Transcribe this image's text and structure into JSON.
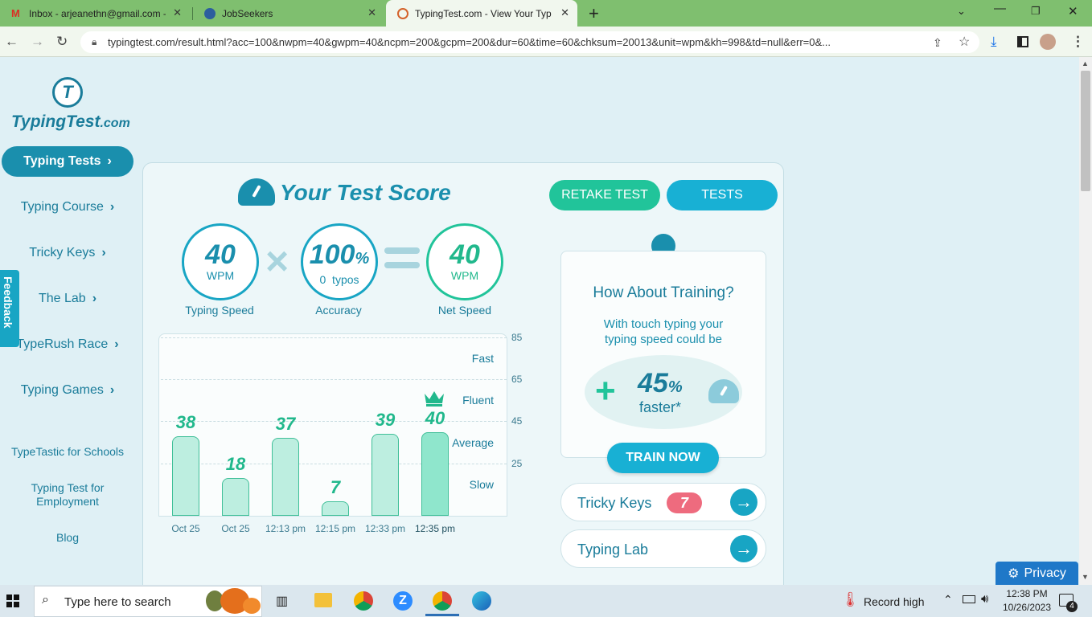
{
  "browser": {
    "tabs": [
      {
        "title": "Inbox - arjeanethn@gmail.com -"
      },
      {
        "title": "JobSeekers"
      },
      {
        "title": "TypingTest.com - View Your Typi"
      }
    ],
    "url": "typingtest.com/result.html?acc=100&nwpm=40&gwpm=40&ncpm=200&gcpm=200&dur=60&time=60&chksum=20013&unit=wpm&kh=998&td=null&err=0&..."
  },
  "sidebar": {
    "logo_text": "TypingTest",
    "logo_suffix": ".com",
    "active_item": "Typing Tests",
    "items": [
      "Typing Course",
      "Tricky Keys",
      "The Lab",
      "TypeRush Race",
      "Typing Games"
    ],
    "links": [
      "TypeTastic for Schools",
      "Typing Test for Employment",
      "Blog"
    ],
    "feedback": "Feedback"
  },
  "score": {
    "title": "Your Test Score",
    "retake": "RETAKE TEST",
    "tests": "TESTS",
    "speed_value": "40",
    "speed_unit": "WPM",
    "speed_label": "Typing Speed",
    "accuracy_value": "100",
    "accuracy_pct": "%",
    "typos": "0  typos",
    "accuracy_label": "Accuracy",
    "net_value": "40",
    "net_unit": "WPM",
    "net_label": "Net Speed"
  },
  "chart_data": {
    "type": "bar",
    "categories": [
      "Oct 25",
      "Oct 25",
      "12:13 pm",
      "12:15 pm",
      "12:33 pm",
      "12:35 pm"
    ],
    "values": [
      38,
      18,
      37,
      7,
      39,
      40
    ],
    "y_ticks": [
      "85",
      "65",
      "45",
      "25"
    ],
    "zones": [
      "Fast",
      "Fluent",
      "Average",
      "Slow"
    ],
    "ylim": [
      0,
      85
    ],
    "highlight_index": 5
  },
  "training": {
    "title": "How About Training?",
    "text": "With touch typing your typing speed could be",
    "percent": "45",
    "pct_sign": "%",
    "faster": "faster*",
    "button": "TRAIN NOW"
  },
  "links": {
    "tricky_keys": "Tricky Keys",
    "tricky_badge": "7",
    "typing_lab": "Typing Lab"
  },
  "privacy": "Privacy",
  "taskbar": {
    "search_placeholder": "Type here to search",
    "weather": "Record high",
    "time": "12:38 PM",
    "date": "10/26/2023",
    "notifications": "4"
  }
}
